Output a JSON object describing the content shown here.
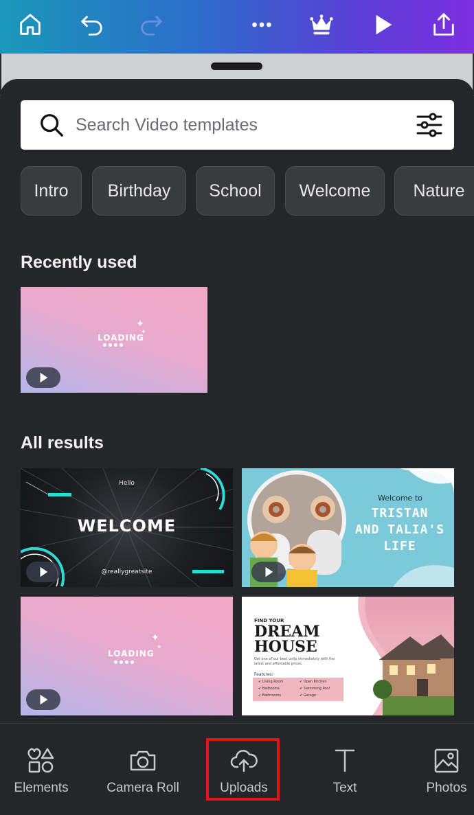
{
  "toolbar": {
    "gradient_colors": [
      "#1a97b9",
      "#2b6fc9",
      "#5a3fd6",
      "#7b2fe0"
    ],
    "buttons": [
      "home-icon",
      "undo-icon",
      "redo-icon",
      "more-icon",
      "crown-icon",
      "play-icon",
      "share-icon"
    ]
  },
  "search": {
    "placeholder": "Search Video templates",
    "value": ""
  },
  "chips": [
    "Intro",
    "Birthday",
    "School",
    "Welcome",
    "Nature"
  ],
  "sections": {
    "recently_used": "Recently used",
    "all_results": "All results"
  },
  "thumbnails": {
    "loading": {
      "label": "LOADING"
    },
    "welcome": {
      "hello": "Hello",
      "title": "WELCOME",
      "site": "@reallygreatsite"
    },
    "tristan": {
      "welcome_to": "Welcome to",
      "title_line1": "TRISTAN",
      "title_line2": "AND TALIA'S",
      "title_line3": "LIFE"
    },
    "dream": {
      "find_your": "FIND YOUR",
      "title_line1": "DREAM",
      "title_line2": "HOUSE",
      "subtitle": "Get one of our best units immediately with the latest and affordable prices.",
      "features_label": "Features:",
      "features": [
        "Living Room",
        "Open Kitchen",
        "Bedrooms",
        "Swimming Pool",
        "Bathrooms",
        "Garage"
      ]
    }
  },
  "bottom_nav": {
    "items": [
      {
        "label": "Elements",
        "icon": "elements-icon"
      },
      {
        "label": "Camera Roll",
        "icon": "camera-icon"
      },
      {
        "label": "Uploads",
        "icon": "upload-cloud-icon"
      },
      {
        "label": "Text",
        "icon": "text-icon"
      },
      {
        "label": "Photos",
        "icon": "photos-icon"
      }
    ],
    "highlighted": "Uploads",
    "highlight_color": "#e4141a"
  },
  "colors": {
    "sheet_bg": "#252629",
    "chip_bg": "#3a3b3f",
    "accent_cyan": "#2fd9d6"
  }
}
